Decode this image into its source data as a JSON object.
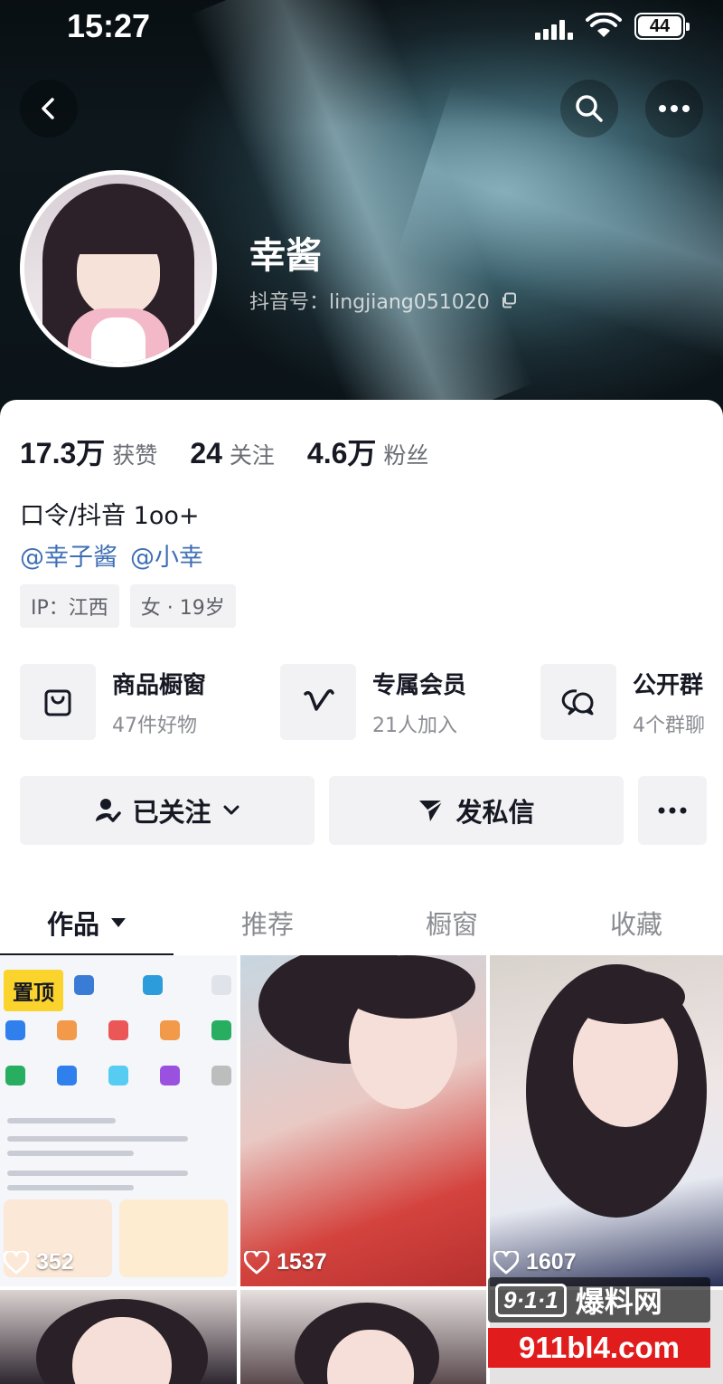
{
  "status_bar": {
    "time": "15:27",
    "battery": "44"
  },
  "profile": {
    "name": "幸酱",
    "douyin_id": "抖音号：lingjiang051020"
  },
  "stats": [
    {
      "value": "17.3万",
      "label": "获赞"
    },
    {
      "value": "24",
      "label": "关注"
    },
    {
      "value": "4.6万",
      "label": "粉丝"
    }
  ],
  "bio": "口令/抖音 1oo+",
  "mentions": [
    "@幸子酱",
    "@小幸"
  ],
  "tags": [
    "IP：江西",
    "女 · 19岁"
  ],
  "entries": [
    {
      "title": "商品橱窗",
      "subtitle": "47件好物",
      "icon": "bag-icon"
    },
    {
      "title": "专属会员",
      "subtitle": "21人加入",
      "icon": "v-icon"
    },
    {
      "title": "公开群",
      "subtitle": "4个群聊",
      "icon": "chat-bubbles-icon"
    }
  ],
  "actions": {
    "follow": "已关注",
    "message": "发私信",
    "more": "···"
  },
  "tabs": [
    {
      "label": "作品",
      "active": true
    },
    {
      "label": "推荐",
      "active": false
    },
    {
      "label": "橱窗",
      "active": false
    },
    {
      "label": "收藏",
      "active": false
    }
  ],
  "videos": [
    {
      "likes": "352",
      "pinned_label": "置顶"
    },
    {
      "likes": "1537"
    },
    {
      "likes": "1607"
    }
  ],
  "watermark": {
    "logo": "9·1·1",
    "name": "爆料网",
    "url": "911bl4.com"
  },
  "colors": {
    "mention": "#3f6fb5",
    "pinned": "#fbd32d",
    "watermark_red": "#e01c1c"
  }
}
